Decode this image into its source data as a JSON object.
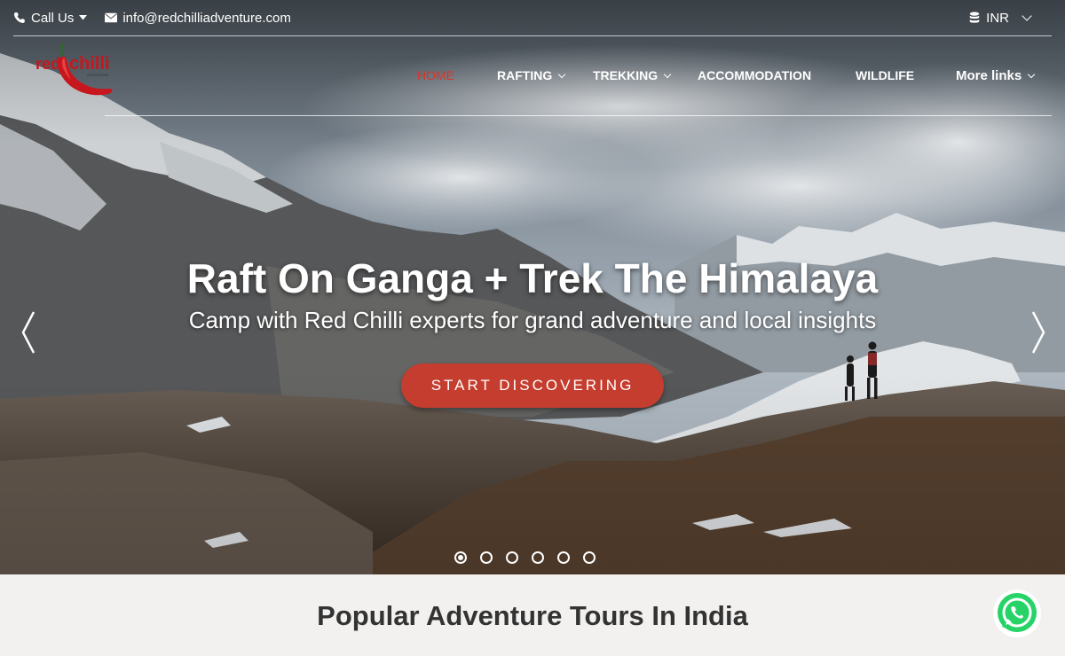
{
  "topbar": {
    "call_label": "Call Us",
    "email": "info@redchilliadventure.com",
    "currency": "INR"
  },
  "brand": {
    "logo_text_red": "red",
    "logo_text_chilli": "chilli",
    "logo_tagline": "ADVENTURE"
  },
  "nav": {
    "items": [
      {
        "label": "HOME",
        "active": true
      },
      {
        "label": "RAFTING",
        "dropdown": true
      },
      {
        "label": "TREKKING",
        "dropdown": true
      },
      {
        "label": "ACCOMMODATION"
      },
      {
        "label": "WILDLIFE"
      },
      {
        "label": "More links",
        "dropdown": true
      }
    ]
  },
  "hero": {
    "title": "Raft On Ganga + Trek The Himalaya",
    "subtitle": "Camp with Red Chilli experts for grand adventure and local insights",
    "cta_label": "START DISCOVERING",
    "slide_count": 6,
    "active_slide": 1
  },
  "section": {
    "title": "Popular Adventure Tours In India"
  },
  "colors": {
    "accent": "#c53d2f",
    "nav_active": "#d7352b",
    "whatsapp": "#25d366"
  },
  "icons": [
    "phone-icon",
    "envelope-icon",
    "database-icon",
    "chevron-left-icon",
    "chevron-right-icon",
    "whatsapp-icon"
  ]
}
